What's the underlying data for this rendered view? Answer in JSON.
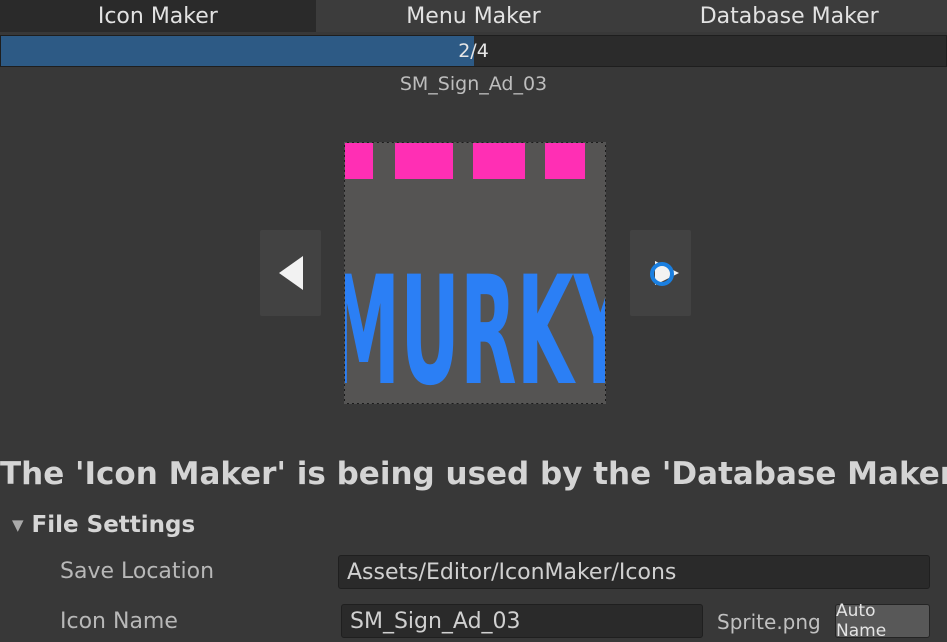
{
  "tabs": [
    {
      "label": "Icon Maker"
    },
    {
      "label": "Menu Maker"
    },
    {
      "label": "Database Maker"
    }
  ],
  "progress": {
    "text": "2/4",
    "fraction": 0.5
  },
  "asset_name": "SM_Sign_Ad_03",
  "preview": {
    "image_text": "MURKY"
  },
  "navigation": {
    "prev_icon": "triangle-left-icon",
    "next_icon": "triangle-right-icon"
  },
  "banner": "The 'Icon Maker' is being used by the 'Database Maker'",
  "file_settings": {
    "title": "File Settings",
    "save_location_label": "Save Location",
    "save_location_value": "Assets/Editor/IconMaker/Icons",
    "icon_name_label": "Icon Name",
    "icon_name_value": "SM_Sign_Ad_03",
    "suffix": "Sprite.png",
    "auto_name_label": "Auto Name"
  },
  "colors": {
    "background": "#383838",
    "progress_fill": "#2d5a85",
    "sign_pink": "#ff2fb4",
    "sign_blue": "#2b7ff5"
  }
}
